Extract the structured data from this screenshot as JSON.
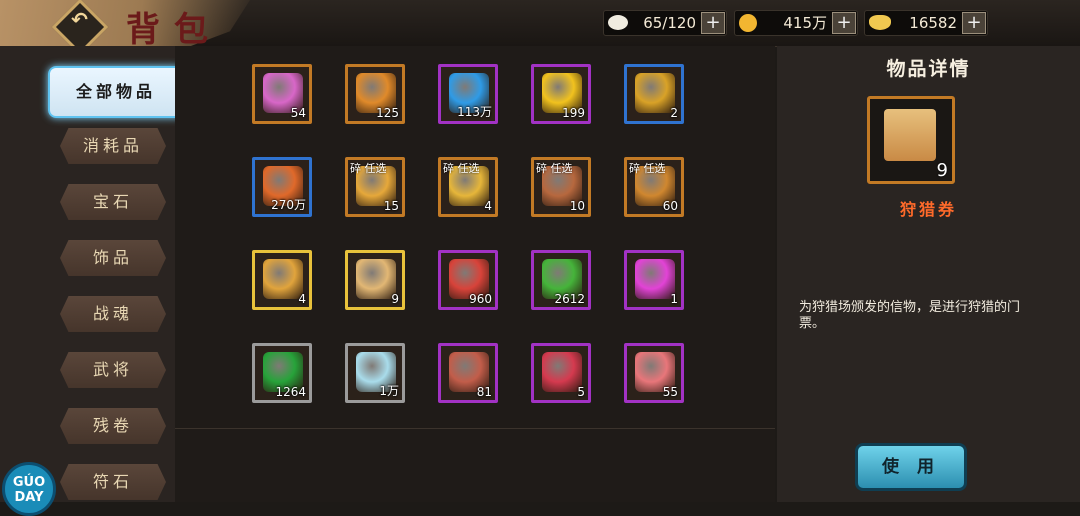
{
  "header": {
    "title": "背包",
    "back_icon": "back-arrow-icon",
    "resources": [
      {
        "name": "rice-ball",
        "icon": "rice-ball-icon",
        "value": "65/120",
        "color": "#f0ece0"
      },
      {
        "name": "coin",
        "icon": "gold-coin-icon",
        "value": "415万",
        "color": "#f2b631"
      },
      {
        "name": "ingot",
        "icon": "gold-ingot-icon",
        "value": "16582",
        "color": "#f0c850"
      }
    ]
  },
  "sidebar": {
    "tabs": [
      {
        "label": "全部物品",
        "active": true
      },
      {
        "label": "消耗品",
        "active": false
      },
      {
        "label": "宝石",
        "active": false
      },
      {
        "label": "饰品",
        "active": false
      },
      {
        "label": "战魂",
        "active": false
      },
      {
        "label": "武将",
        "active": false
      },
      {
        "label": "残卷",
        "active": false
      },
      {
        "label": "符石",
        "active": false
      }
    ],
    "logo_text": "GÚO DAY"
  },
  "items": [
    {
      "icon": "rainbow-gem-icon",
      "count": "54",
      "frame": "orange",
      "color": "#d867c8",
      "tag": ""
    },
    {
      "icon": "golden-fruit-icon",
      "count": "125",
      "frame": "orange",
      "color": "#e08a2a",
      "tag": ""
    },
    {
      "icon": "blue-gem-icon",
      "count": "113万",
      "frame": "purple",
      "color": "#2f9be6",
      "tag": ""
    },
    {
      "icon": "smiley-coin-icon",
      "count": "199",
      "frame": "purple",
      "color": "#f1c21e",
      "tag": ""
    },
    {
      "icon": "gold-token-icon",
      "count": "2",
      "frame": "blue",
      "color": "#d9a227",
      "tag": ""
    },
    {
      "icon": "red-stone-icon",
      "count": "270万",
      "frame": "blue",
      "color": "#e0692a",
      "tag": ""
    },
    {
      "icon": "treasure-chest-icon",
      "count": "15",
      "frame": "orange",
      "color": "#e6a83a",
      "tag": "碎  任选"
    },
    {
      "icon": "treasure-chest-icon",
      "count": "4",
      "frame": "orange",
      "color": "#e6b63a",
      "tag": "碎  任选"
    },
    {
      "icon": "treasure-chest-icon",
      "count": "10",
      "frame": "orange",
      "color": "#b7683e",
      "tag": "碎  任选"
    },
    {
      "icon": "treasure-chest-icon",
      "count": "60",
      "frame": "orange",
      "color": "#d0872f",
      "tag": "碎  任选"
    },
    {
      "icon": "medal-icon",
      "count": "4",
      "frame": "gold",
      "color": "#e1a43c",
      "tag": ""
    },
    {
      "icon": "hunting-scroll-icon",
      "count": "9",
      "frame": "gold",
      "color": "#e2b774",
      "tag": ""
    },
    {
      "icon": "shirt-puzzle-icon",
      "count": "960",
      "frame": "purple",
      "color": "#d8433a",
      "tag": ""
    },
    {
      "icon": "green-orb-icon",
      "count": "2612",
      "frame": "purple",
      "color": "#45b43a",
      "tag": ""
    },
    {
      "icon": "magic-orb-icon",
      "count": "1",
      "frame": "purple",
      "color": "#e243d6",
      "tag": ""
    },
    {
      "icon": "green-crystal-icon",
      "count": "1264",
      "frame": "gray",
      "color": "#27a33a",
      "tag": ""
    },
    {
      "icon": "ice-crystal-icon",
      "count": "1万",
      "frame": "gray",
      "color": "#a9dceb",
      "tag": ""
    },
    {
      "icon": "torn-scroll-icon",
      "count": "81",
      "frame": "purple",
      "color": "#c25d4a",
      "tag": ""
    },
    {
      "icon": "lucky-bag-icon",
      "count": "5",
      "frame": "purple",
      "color": "#d53a4f",
      "tag": ""
    },
    {
      "icon": "ranking-card-icon",
      "count": "55",
      "frame": "purple",
      "color": "#e8767a",
      "tag": ""
    }
  ],
  "detail": {
    "title": "物品详情",
    "item_icon": "hunting-scroll-icon",
    "count": "9",
    "name": "狩猎券",
    "description": "为狩猎场颁发的信物，是进行狩猎的门票。",
    "use_label": "使 用"
  }
}
